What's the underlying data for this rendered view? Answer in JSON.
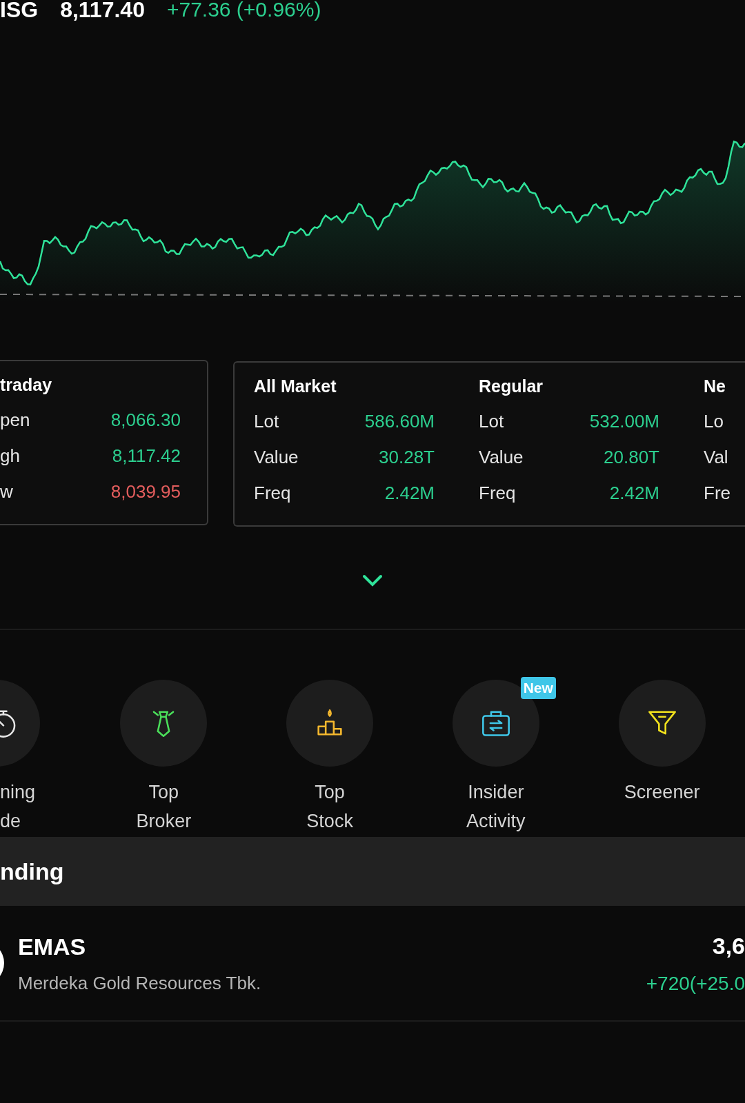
{
  "index": {
    "symbol": "ISG",
    "price": "8,117.40",
    "change": "+77.36 (+0.96%)",
    "color": "#2ccf8f"
  },
  "stat_cards": [
    {
      "groups": [
        {
          "title": "traday",
          "rows": [
            {
              "label": "pen",
              "value": "8,066.30",
              "color": "#2ccf8f"
            },
            {
              "label": "gh",
              "value": "8,117.42",
              "color": "#2ccf8f"
            },
            {
              "label": "w",
              "value": "8,039.95",
              "color": "#e35d5d"
            }
          ]
        }
      ]
    },
    {
      "groups": [
        {
          "title": "All Market",
          "rows": [
            {
              "label": "Lot",
              "value": "586.60M",
              "color": "#2ccf8f"
            },
            {
              "label": "Value",
              "value": "30.28T",
              "color": "#2ccf8f"
            },
            {
              "label": "Freq",
              "value": "2.42M",
              "color": "#2ccf8f"
            }
          ]
        },
        {
          "title": "Regular",
          "rows": [
            {
              "label": "Lot",
              "value": "532.00M",
              "color": "#2ccf8f"
            },
            {
              "label": "Value",
              "value": "20.80T",
              "color": "#2ccf8f"
            },
            {
              "label": "Freq",
              "value": "2.42M",
              "color": "#2ccf8f"
            }
          ]
        },
        {
          "title": "Ne",
          "rows": [
            {
              "label": "Lo"
            },
            {
              "label": "Val"
            },
            {
              "label": "Fre"
            }
          ]
        }
      ]
    }
  ],
  "menu": [
    {
      "kind": "stopwatch",
      "lines": [
        "ning",
        "de"
      ],
      "color": "#e5e5e5"
    },
    {
      "kind": "tie",
      "lines": [
        "Top",
        "Broker"
      ],
      "color": "#4ade5a"
    },
    {
      "kind": "podium",
      "lines": [
        "Top",
        "Stock"
      ],
      "color": "#f5b82e"
    },
    {
      "kind": "briefcase",
      "lines": [
        "Insider",
        "Activity"
      ],
      "badge": "New",
      "color": "#3fc6e8"
    },
    {
      "kind": "funnel",
      "lines": [
        "Screener"
      ],
      "color": "#f2e21d"
    }
  ],
  "trending": {
    "title": "nding",
    "items": [
      {
        "symbol": "EMAS",
        "name": "Merdeka Gold Resources Tbk.",
        "price": "3,6",
        "change": "+720(+25.0",
        "color": "#2ccf8f"
      }
    ]
  }
}
